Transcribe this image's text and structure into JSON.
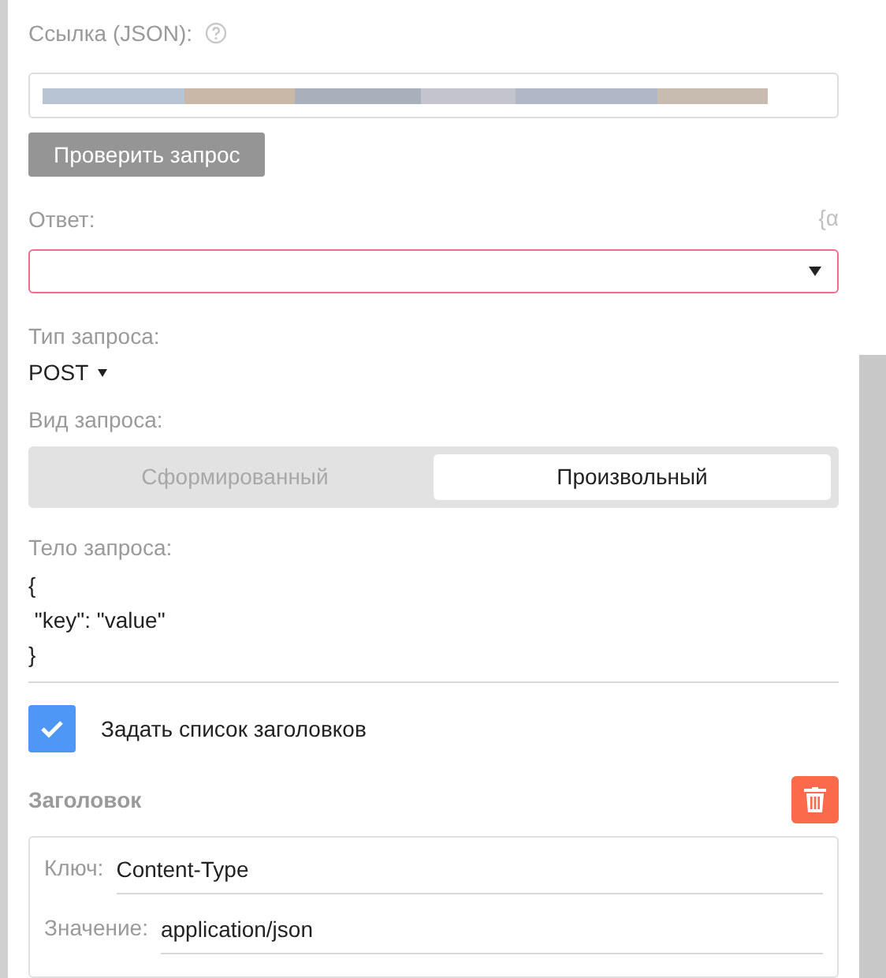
{
  "url_field": {
    "label": "Ссылка (JSON):"
  },
  "check_button": "Проверить запрос",
  "response": {
    "label": "Ответ:",
    "variable_icon": "{α",
    "invalid": true
  },
  "request_type": {
    "label": "Тип запроса:",
    "value": "POST"
  },
  "request_kind": {
    "label": "Вид запроса:",
    "options": [
      {
        "label": "Сформированный",
        "selected": false
      },
      {
        "label": "Произвольный",
        "selected": true
      }
    ]
  },
  "body": {
    "label": "Тело запроса:",
    "lines": [
      "{",
      " \"key\": \"value\"",
      "}"
    ]
  },
  "headers_toggle": {
    "label": "Задать список заголовков",
    "checked": true
  },
  "header": {
    "title": "Заголовок",
    "fields": [
      {
        "label": "Ключ:",
        "value": "Content-Type"
      },
      {
        "label": "Значение:",
        "value": "application/json"
      }
    ]
  }
}
